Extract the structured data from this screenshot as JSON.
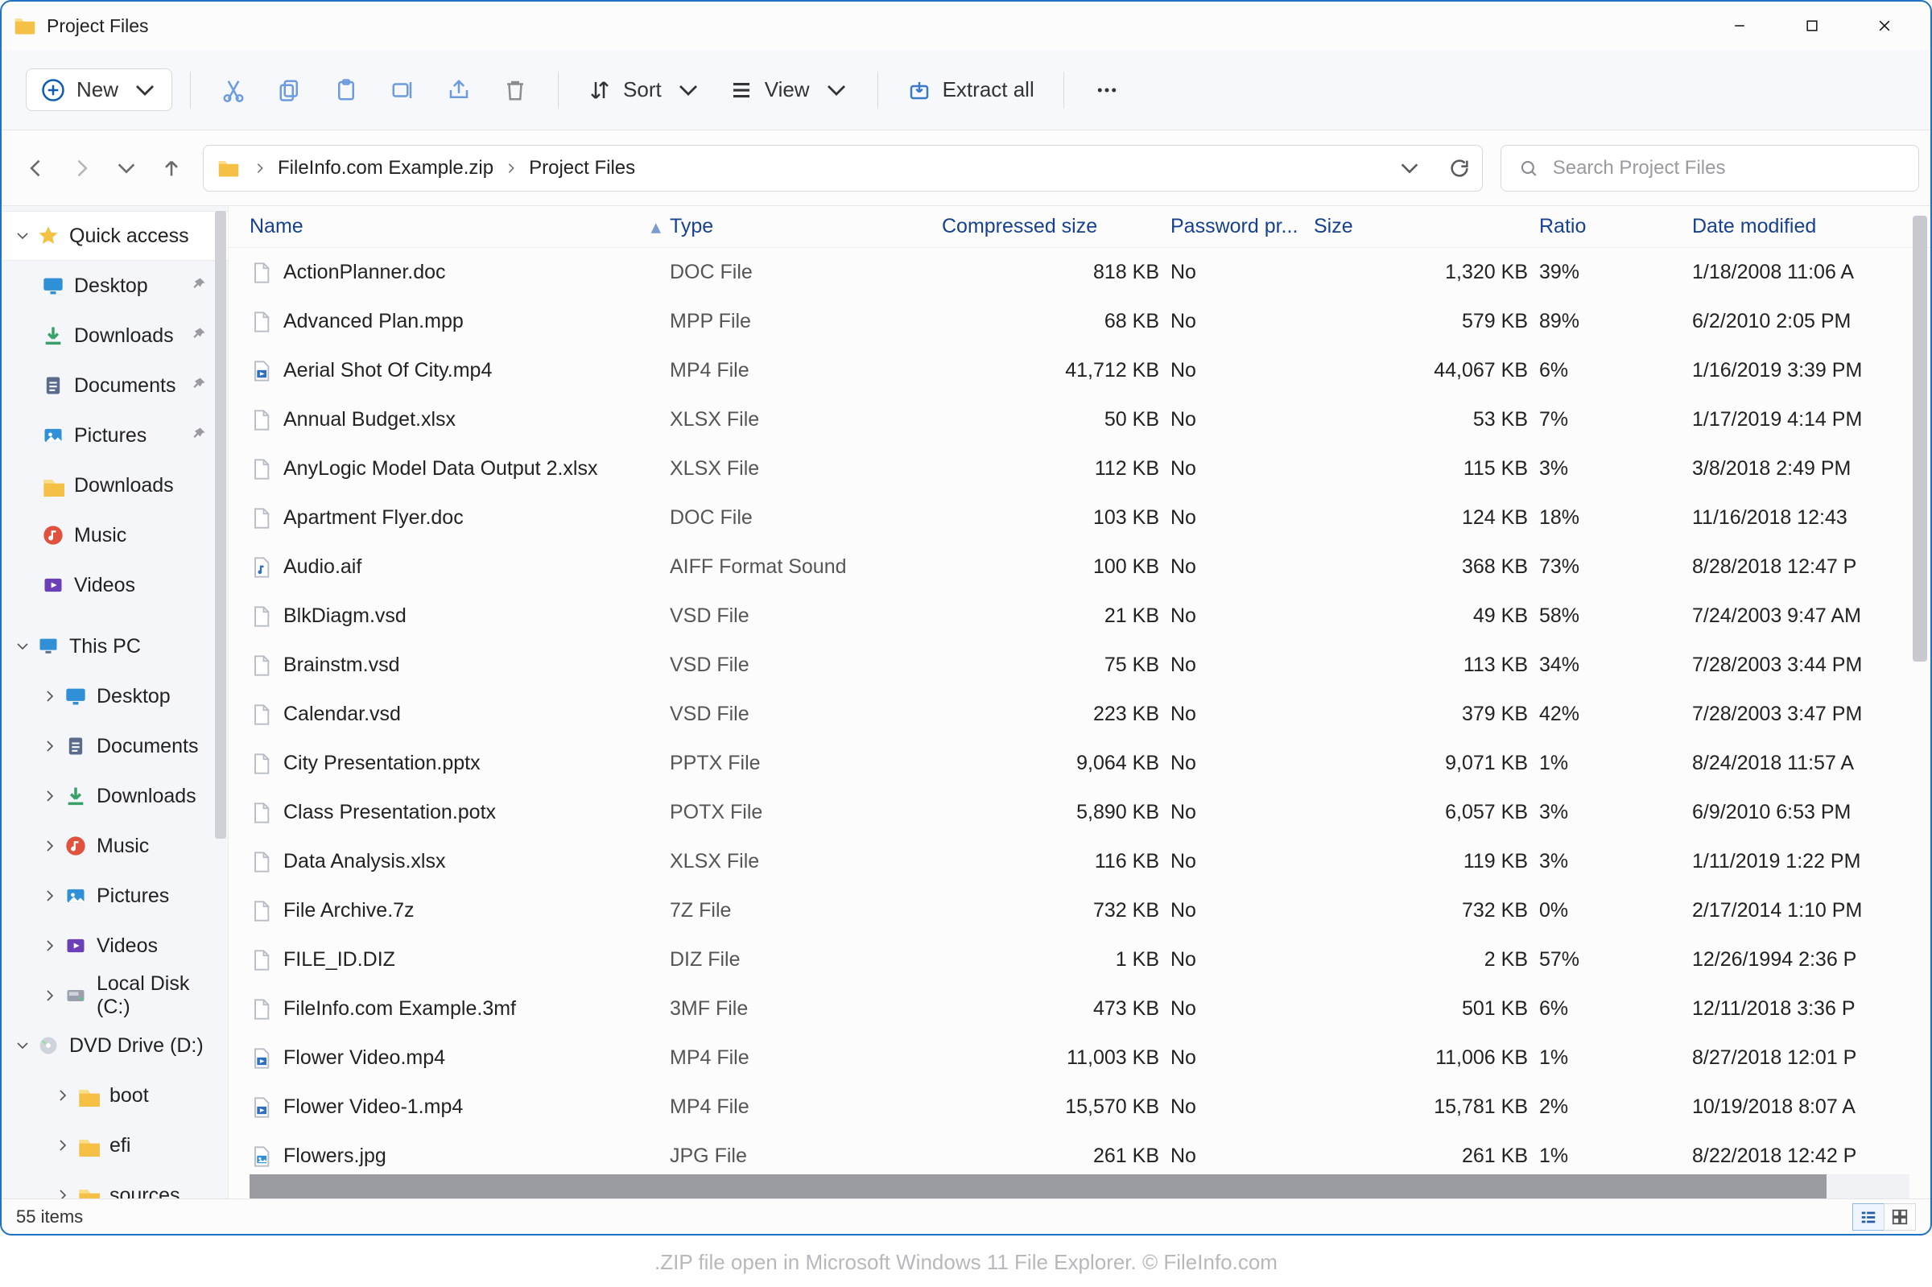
{
  "window": {
    "title": "Project Files"
  },
  "toolbar": {
    "new_label": "New",
    "sort_label": "Sort",
    "view_label": "View",
    "extract_label": "Extract all"
  },
  "breadcrumb": {
    "zip": "FileInfo.com Example.zip",
    "folder": "Project Files"
  },
  "search": {
    "placeholder": "Search Project Files"
  },
  "sidebar": {
    "quick_access": "Quick access",
    "qa_items": [
      {
        "label": "Desktop",
        "icon": "desktop",
        "pinned": true
      },
      {
        "label": "Downloads",
        "icon": "download",
        "pinned": true
      },
      {
        "label": "Documents",
        "icon": "document",
        "pinned": true
      },
      {
        "label": "Pictures",
        "icon": "pictures",
        "pinned": true
      },
      {
        "label": "Downloads",
        "icon": "folder",
        "pinned": false
      },
      {
        "label": "Music",
        "icon": "music",
        "pinned": false
      },
      {
        "label": "Videos",
        "icon": "videos",
        "pinned": false
      }
    ],
    "this_pc": "This PC",
    "pc_items": [
      {
        "label": "Desktop",
        "icon": "desktop"
      },
      {
        "label": "Documents",
        "icon": "document"
      },
      {
        "label": "Downloads",
        "icon": "download"
      },
      {
        "label": "Music",
        "icon": "music"
      },
      {
        "label": "Pictures",
        "icon": "pictures"
      },
      {
        "label": "Videos",
        "icon": "videos"
      },
      {
        "label": "Local Disk (C:)",
        "icon": "disk"
      }
    ],
    "dvd": "DVD Drive (D:)",
    "dvd_items": [
      {
        "label": "boot"
      },
      {
        "label": "efi"
      },
      {
        "label": "sources"
      }
    ]
  },
  "columns": {
    "name": "Name",
    "type": "Type",
    "compressed": "Compressed size",
    "password": "Password pr...",
    "size": "Size",
    "ratio": "Ratio",
    "date": "Date modified"
  },
  "files": [
    {
      "name": "ActionPlanner.doc",
      "type": "DOC File",
      "comp": "818 KB",
      "pwd": "No",
      "size": "1,320 KB",
      "ratio": "39%",
      "date": "1/18/2008 11:06 A",
      "icon": "doc"
    },
    {
      "name": "Advanced Plan.mpp",
      "type": "MPP File",
      "comp": "68 KB",
      "pwd": "No",
      "size": "579 KB",
      "ratio": "89%",
      "date": "6/2/2010 2:05 PM",
      "icon": "doc"
    },
    {
      "name": "Aerial Shot Of City.mp4",
      "type": "MP4 File",
      "comp": "41,712 KB",
      "pwd": "No",
      "size": "44,067 KB",
      "ratio": "6%",
      "date": "1/16/2019 3:39 PM",
      "icon": "video"
    },
    {
      "name": "Annual Budget.xlsx",
      "type": "XLSX File",
      "comp": "50 KB",
      "pwd": "No",
      "size": "53 KB",
      "ratio": "7%",
      "date": "1/17/2019 4:14 PM",
      "icon": "doc"
    },
    {
      "name": "AnyLogic Model Data Output 2.xlsx",
      "type": "XLSX File",
      "comp": "112 KB",
      "pwd": "No",
      "size": "115 KB",
      "ratio": "3%",
      "date": "3/8/2018 2:49 PM",
      "icon": "doc"
    },
    {
      "name": "Apartment Flyer.doc",
      "type": "DOC File",
      "comp": "103 KB",
      "pwd": "No",
      "size": "124 KB",
      "ratio": "18%",
      "date": "11/16/2018 12:43",
      "icon": "doc"
    },
    {
      "name": "Audio.aif",
      "type": "AIFF Format Sound",
      "comp": "100 KB",
      "pwd": "No",
      "size": "368 KB",
      "ratio": "73%",
      "date": "8/28/2018 12:47 P",
      "icon": "audio"
    },
    {
      "name": "BlkDiagm.vsd",
      "type": "VSD File",
      "comp": "21 KB",
      "pwd": "No",
      "size": "49 KB",
      "ratio": "58%",
      "date": "7/24/2003 9:47 AM",
      "icon": "doc"
    },
    {
      "name": "Brainstm.vsd",
      "type": "VSD File",
      "comp": "75 KB",
      "pwd": "No",
      "size": "113 KB",
      "ratio": "34%",
      "date": "7/28/2003 3:44 PM",
      "icon": "doc"
    },
    {
      "name": "Calendar.vsd",
      "type": "VSD File",
      "comp": "223 KB",
      "pwd": "No",
      "size": "379 KB",
      "ratio": "42%",
      "date": "7/28/2003 3:47 PM",
      "icon": "doc"
    },
    {
      "name": "City Presentation.pptx",
      "type": "PPTX File",
      "comp": "9,064 KB",
      "pwd": "No",
      "size": "9,071 KB",
      "ratio": "1%",
      "date": "8/24/2018 11:57 A",
      "icon": "doc"
    },
    {
      "name": "Class Presentation.potx",
      "type": "POTX File",
      "comp": "5,890 KB",
      "pwd": "No",
      "size": "6,057 KB",
      "ratio": "3%",
      "date": "6/9/2010 6:53 PM",
      "icon": "doc"
    },
    {
      "name": "Data Analysis.xlsx",
      "type": "XLSX File",
      "comp": "116 KB",
      "pwd": "No",
      "size": "119 KB",
      "ratio": "3%",
      "date": "1/11/2019 1:22 PM",
      "icon": "doc"
    },
    {
      "name": "File Archive.7z",
      "type": "7Z File",
      "comp": "732 KB",
      "pwd": "No",
      "size": "732 KB",
      "ratio": "0%",
      "date": "2/17/2014 1:10 PM",
      "icon": "doc"
    },
    {
      "name": "FILE_ID.DIZ",
      "type": "DIZ File",
      "comp": "1 KB",
      "pwd": "No",
      "size": "2 KB",
      "ratio": "57%",
      "date": "12/26/1994 2:36 P",
      "icon": "doc"
    },
    {
      "name": "FileInfo.com Example.3mf",
      "type": "3MF File",
      "comp": "473 KB",
      "pwd": "No",
      "size": "501 KB",
      "ratio": "6%",
      "date": "12/11/2018 3:36 P",
      "icon": "doc"
    },
    {
      "name": "Flower Video.mp4",
      "type": "MP4 File",
      "comp": "11,003 KB",
      "pwd": "No",
      "size": "11,006 KB",
      "ratio": "1%",
      "date": "8/27/2018 12:01 P",
      "icon": "video"
    },
    {
      "name": "Flower Video-1.mp4",
      "type": "MP4 File",
      "comp": "15,570 KB",
      "pwd": "No",
      "size": "15,781 KB",
      "ratio": "2%",
      "date": "10/19/2018 8:07 A",
      "icon": "video"
    },
    {
      "name": "Flowers.jpg",
      "type": "JPG File",
      "comp": "261 KB",
      "pwd": "No",
      "size": "261 KB",
      "ratio": "1%",
      "date": "8/22/2018 12:42 P",
      "icon": "image"
    }
  ],
  "status": {
    "items": "55 items"
  },
  "caption": ".ZIP file open in Microsoft Windows 11 File Explorer. © FileInfo.com"
}
